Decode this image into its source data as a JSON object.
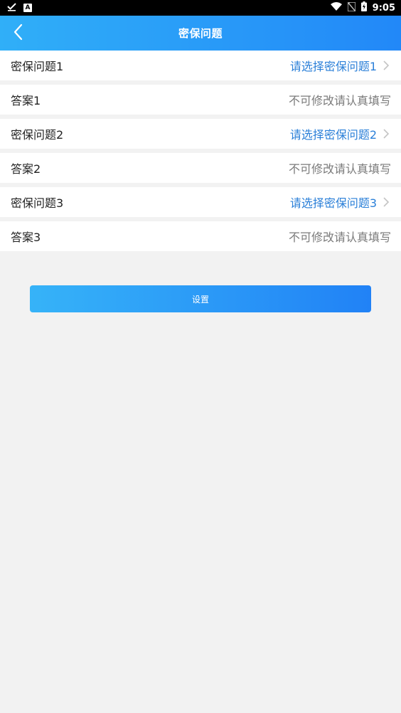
{
  "status_bar": {
    "time": "9:05",
    "left_icons": [
      "download-done-icon",
      "a-notification-icon"
    ],
    "right_icons": [
      "wifi-icon",
      "no-sim-icon",
      "battery-charging-icon"
    ]
  },
  "header": {
    "title": "密保问题",
    "back_icon": "chevron-left-icon"
  },
  "form": {
    "rows": [
      {
        "label": "密保问题1",
        "value": "请选择密保问题1",
        "type": "select"
      },
      {
        "label": "答案1",
        "value": "不可修改请认真填写",
        "type": "input"
      },
      {
        "label": "密保问题2",
        "value": "请选择密保问题2",
        "type": "select"
      },
      {
        "label": "答案2",
        "value": "不可修改请认真填写",
        "type": "input"
      },
      {
        "label": "密保问题3",
        "value": "请选择密保问题3",
        "type": "select"
      },
      {
        "label": "答案3",
        "value": "不可修改请认真填写",
        "type": "input"
      }
    ]
  },
  "submit": {
    "label": "设置"
  },
  "colors": {
    "header_gradient_start": "#30aff8",
    "header_gradient_end": "#2288f8",
    "select_text": "#2a7fd8",
    "hint_text": "#7a7a7a",
    "background": "#f2f2f2"
  }
}
